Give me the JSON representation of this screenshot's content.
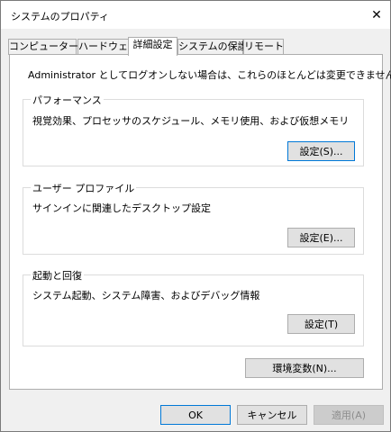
{
  "window": {
    "title": "システムのプロパティ",
    "close_glyph": "✕"
  },
  "tabs": [
    {
      "label": "コンピューター名",
      "active": false
    },
    {
      "label": "ハードウェア",
      "active": false
    },
    {
      "label": "詳細設定",
      "active": true
    },
    {
      "label": "システムの保護",
      "active": false
    },
    {
      "label": "リモート",
      "active": false
    }
  ],
  "notice": "Administrator としてログオンしない場合は、これらのほとんどは変更できません。",
  "performance": {
    "title": "パフォーマンス",
    "description": "視覚効果、プロセッサのスケジュール、メモリ使用、および仮想メモリ",
    "button": "設定(S)..."
  },
  "user_profile": {
    "title": "ユーザー プロファイル",
    "description": "サインインに関連したデスクトップ設定",
    "button": "設定(E)..."
  },
  "startup_recovery": {
    "title": "起動と回復",
    "description": "システム起動、システム障害、およびデバッグ情報",
    "button": "設定(T)"
  },
  "env_button": "環境変数(N)...",
  "footer": {
    "ok": "OK",
    "cancel": "キャンセル",
    "apply": "適用(A)"
  },
  "colors": {
    "focus_border": "#0078d7",
    "button_face": "#e1e1e1",
    "dialog_bg": "#f0f0f0"
  }
}
